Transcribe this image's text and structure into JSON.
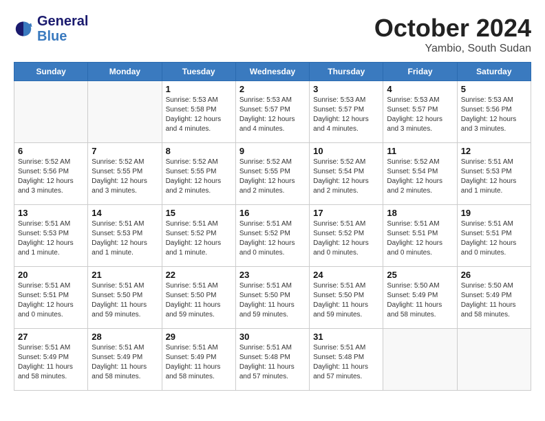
{
  "logo": {
    "line1": "General",
    "line2": "Blue"
  },
  "title": "October 2024",
  "subtitle": "Yambio, South Sudan",
  "headers": [
    "Sunday",
    "Monday",
    "Tuesday",
    "Wednesday",
    "Thursday",
    "Friday",
    "Saturday"
  ],
  "weeks": [
    [
      {
        "day": "",
        "text": ""
      },
      {
        "day": "",
        "text": ""
      },
      {
        "day": "1",
        "text": "Sunrise: 5:53 AM\nSunset: 5:58 PM\nDaylight: 12 hours\nand 4 minutes."
      },
      {
        "day": "2",
        "text": "Sunrise: 5:53 AM\nSunset: 5:57 PM\nDaylight: 12 hours\nand 4 minutes."
      },
      {
        "day": "3",
        "text": "Sunrise: 5:53 AM\nSunset: 5:57 PM\nDaylight: 12 hours\nand 4 minutes."
      },
      {
        "day": "4",
        "text": "Sunrise: 5:53 AM\nSunset: 5:57 PM\nDaylight: 12 hours\nand 3 minutes."
      },
      {
        "day": "5",
        "text": "Sunrise: 5:53 AM\nSunset: 5:56 PM\nDaylight: 12 hours\nand 3 minutes."
      }
    ],
    [
      {
        "day": "6",
        "text": "Sunrise: 5:52 AM\nSunset: 5:56 PM\nDaylight: 12 hours\nand 3 minutes."
      },
      {
        "day": "7",
        "text": "Sunrise: 5:52 AM\nSunset: 5:55 PM\nDaylight: 12 hours\nand 3 minutes."
      },
      {
        "day": "8",
        "text": "Sunrise: 5:52 AM\nSunset: 5:55 PM\nDaylight: 12 hours\nand 2 minutes."
      },
      {
        "day": "9",
        "text": "Sunrise: 5:52 AM\nSunset: 5:55 PM\nDaylight: 12 hours\nand 2 minutes."
      },
      {
        "day": "10",
        "text": "Sunrise: 5:52 AM\nSunset: 5:54 PM\nDaylight: 12 hours\nand 2 minutes."
      },
      {
        "day": "11",
        "text": "Sunrise: 5:52 AM\nSunset: 5:54 PM\nDaylight: 12 hours\nand 2 minutes."
      },
      {
        "day": "12",
        "text": "Sunrise: 5:51 AM\nSunset: 5:53 PM\nDaylight: 12 hours\nand 1 minute."
      }
    ],
    [
      {
        "day": "13",
        "text": "Sunrise: 5:51 AM\nSunset: 5:53 PM\nDaylight: 12 hours\nand 1 minute."
      },
      {
        "day": "14",
        "text": "Sunrise: 5:51 AM\nSunset: 5:53 PM\nDaylight: 12 hours\nand 1 minute."
      },
      {
        "day": "15",
        "text": "Sunrise: 5:51 AM\nSunset: 5:52 PM\nDaylight: 12 hours\nand 1 minute."
      },
      {
        "day": "16",
        "text": "Sunrise: 5:51 AM\nSunset: 5:52 PM\nDaylight: 12 hours\nand 0 minutes."
      },
      {
        "day": "17",
        "text": "Sunrise: 5:51 AM\nSunset: 5:52 PM\nDaylight: 12 hours\nand 0 minutes."
      },
      {
        "day": "18",
        "text": "Sunrise: 5:51 AM\nSunset: 5:51 PM\nDaylight: 12 hours\nand 0 minutes."
      },
      {
        "day": "19",
        "text": "Sunrise: 5:51 AM\nSunset: 5:51 PM\nDaylight: 12 hours\nand 0 minutes."
      }
    ],
    [
      {
        "day": "20",
        "text": "Sunrise: 5:51 AM\nSunset: 5:51 PM\nDaylight: 12 hours\nand 0 minutes."
      },
      {
        "day": "21",
        "text": "Sunrise: 5:51 AM\nSunset: 5:50 PM\nDaylight: 11 hours\nand 59 minutes."
      },
      {
        "day": "22",
        "text": "Sunrise: 5:51 AM\nSunset: 5:50 PM\nDaylight: 11 hours\nand 59 minutes."
      },
      {
        "day": "23",
        "text": "Sunrise: 5:51 AM\nSunset: 5:50 PM\nDaylight: 11 hours\nand 59 minutes."
      },
      {
        "day": "24",
        "text": "Sunrise: 5:51 AM\nSunset: 5:50 PM\nDaylight: 11 hours\nand 59 minutes."
      },
      {
        "day": "25",
        "text": "Sunrise: 5:50 AM\nSunset: 5:49 PM\nDaylight: 11 hours\nand 58 minutes."
      },
      {
        "day": "26",
        "text": "Sunrise: 5:50 AM\nSunset: 5:49 PM\nDaylight: 11 hours\nand 58 minutes."
      }
    ],
    [
      {
        "day": "27",
        "text": "Sunrise: 5:51 AM\nSunset: 5:49 PM\nDaylight: 11 hours\nand 58 minutes."
      },
      {
        "day": "28",
        "text": "Sunrise: 5:51 AM\nSunset: 5:49 PM\nDaylight: 11 hours\nand 58 minutes."
      },
      {
        "day": "29",
        "text": "Sunrise: 5:51 AM\nSunset: 5:49 PM\nDaylight: 11 hours\nand 58 minutes."
      },
      {
        "day": "30",
        "text": "Sunrise: 5:51 AM\nSunset: 5:48 PM\nDaylight: 11 hours\nand 57 minutes."
      },
      {
        "day": "31",
        "text": "Sunrise: 5:51 AM\nSunset: 5:48 PM\nDaylight: 11 hours\nand 57 minutes."
      },
      {
        "day": "",
        "text": ""
      },
      {
        "day": "",
        "text": ""
      }
    ]
  ]
}
